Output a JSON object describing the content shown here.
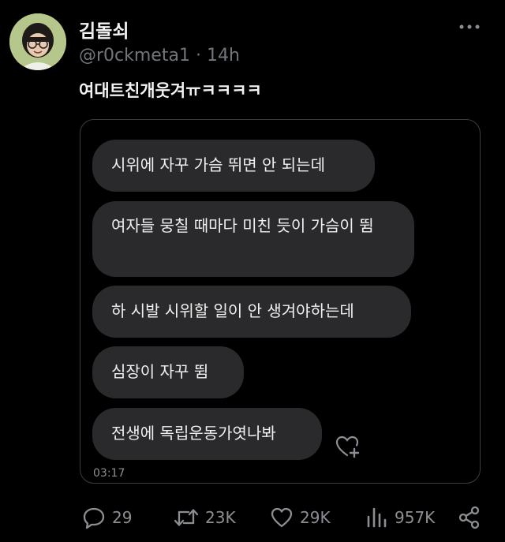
{
  "tweet": {
    "display_name": "김돌쇠",
    "handle": "@r0ckmeta1",
    "separator": "·",
    "age": "14h",
    "text": "여대트친개웃겨ㅠㅋㅋㅋㅋ",
    "more_icon": "more-icon"
  },
  "media": {
    "messages": [
      {
        "text": "시위에 자꾸 가슴 뛰면 안 되는데"
      },
      {
        "text": "여자들 뭉칠 때마다 미친 듯이 가슴이 뜀"
      },
      {
        "text": "하 시발 시위할 일이 안 생겨야하는데"
      },
      {
        "text": "심장이 자꾸 뜀"
      },
      {
        "text": "전생에 독립운동가엿나봐"
      }
    ],
    "timestamp": "03:17",
    "react_icon": "add-reaction-icon"
  },
  "actions": {
    "replies": "29",
    "retweets": "23K",
    "likes": "29K",
    "views": "957K",
    "share_icon": "share-icon"
  },
  "colors": {
    "background": "#000000",
    "bubble": "#2a2a2c",
    "muted": "#71767b",
    "text": "#e7e9ea"
  }
}
